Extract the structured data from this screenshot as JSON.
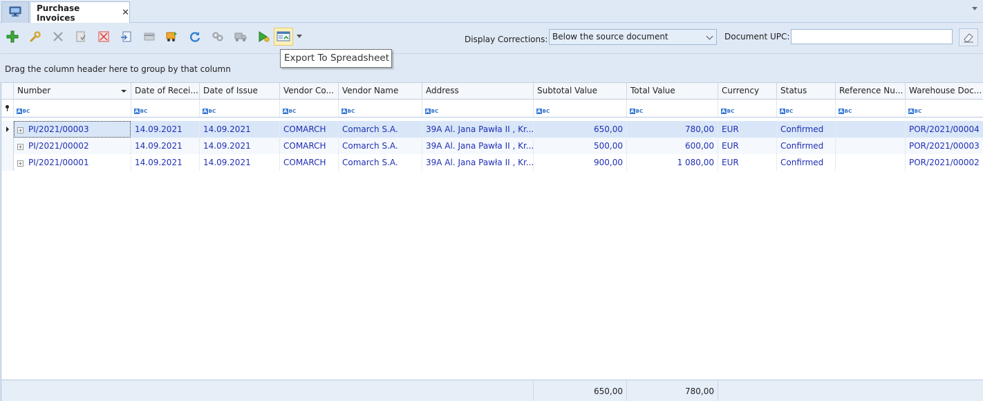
{
  "tabs": {
    "home_icon": "computer-icon",
    "active_tab": "Purchase Invoices",
    "close_glyph": "✕"
  },
  "toolbar": {
    "buttons": [
      {
        "name": "add",
        "icon": "plus-icon"
      },
      {
        "name": "edit",
        "icon": "wrench-icon"
      },
      {
        "name": "delete",
        "icon": "delete-x-icon"
      },
      {
        "name": "confirm",
        "icon": "document-confirm-icon"
      },
      {
        "name": "cancel-document",
        "icon": "document-cancel-icon"
      },
      {
        "name": "generate",
        "icon": "document-generate-icon"
      },
      {
        "name": "payment",
        "icon": "card-icon"
      },
      {
        "name": "transfer",
        "icon": "transfer-icon"
      },
      {
        "name": "refresh",
        "icon": "refresh-icon"
      },
      {
        "name": "settings",
        "icon": "gears-icon"
      },
      {
        "name": "delivery",
        "icon": "truck-icon"
      },
      {
        "name": "run",
        "icon": "run-icon"
      },
      {
        "name": "export-spreadsheet",
        "icon": "spreadsheet-icon"
      }
    ],
    "display_corrections_label": "Display Corrections:",
    "display_corrections_value": "Below the source document",
    "document_upc_label": "Document UPC:",
    "document_upc_value": ""
  },
  "tooltip": {
    "text": "Export To Spreadsheet"
  },
  "group_panel": {
    "text": "Drag the column header here to group by that column"
  },
  "grid": {
    "columns": [
      "Number",
      "Date of Recei...",
      "Date of Issue",
      "Vendor Co...",
      "Vendor Name",
      "Address",
      "Subtotal Value",
      "Total Value",
      "Currency",
      "Status",
      "Reference Nu...",
      "Warehouse Doc..."
    ],
    "filter_icon": "abc-filter-icon",
    "rows": [
      [
        "PI/2021/00003",
        "14.09.2021",
        "14.09.2021",
        "COMARCH",
        "Comarch S.A.",
        "39A Al. Jana Pawła II , Kr...",
        "650,00",
        "780,00",
        "EUR",
        "Confirmed",
        "",
        "POR/2021/00004"
      ],
      [
        "PI/2021/00002",
        "14.09.2021",
        "14.09.2021",
        "COMARCH",
        "Comarch S.A.",
        "39A Al. Jana Pawła II , Kr...",
        "500,00",
        "600,00",
        "EUR",
        "Confirmed",
        "",
        "POR/2021/00003"
      ],
      [
        "PI/2021/00001",
        "14.09.2021",
        "14.09.2021",
        "COMARCH",
        "Comarch S.A.",
        "39A Al. Jana Pawła II , Kr...",
        "900,00",
        "1 080,00",
        "EUR",
        "Confirmed",
        "",
        "POR/2021/00002"
      ]
    ],
    "footer": {
      "subtotal": "650,00",
      "total": "780,00"
    }
  }
}
